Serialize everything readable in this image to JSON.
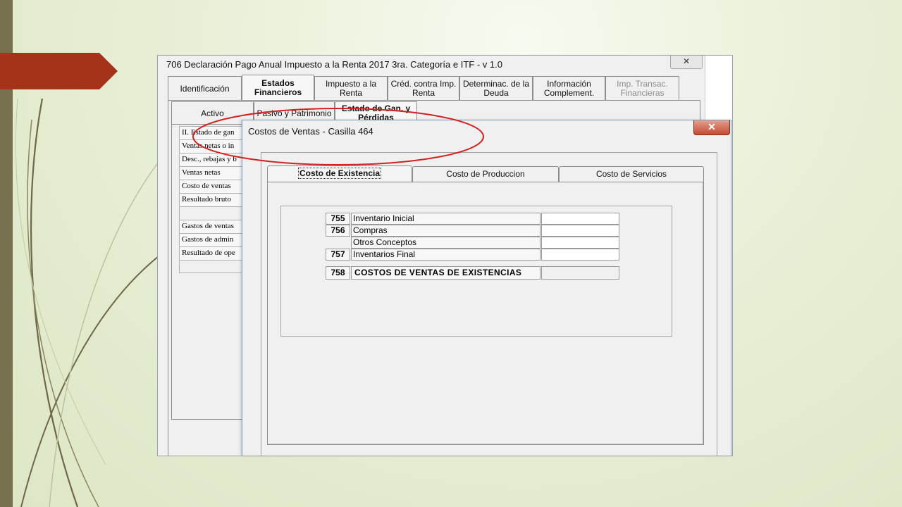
{
  "main_window": {
    "title": "706 Declaración Pago Anual Impuesto a la Renta 2017 3ra. Categoría e ITF - v 1.0",
    "close_label": "✕",
    "tabs": [
      {
        "label": "Identificación"
      },
      {
        "label": "Estados Financieros"
      },
      {
        "label": "Impuesto a la Renta"
      },
      {
        "label": "Créd. contra Imp. Renta"
      },
      {
        "label": "Determinac. de la Deuda"
      },
      {
        "label": "Información Complement."
      },
      {
        "label": "Imp. Transac. Financieras"
      }
    ],
    "subtabs": [
      {
        "label": "Activo"
      },
      {
        "label": "Pasivo y Patrimonio"
      },
      {
        "label": "Estado de Gan. y Pérdidas"
      }
    ],
    "rows": [
      "II. Estado de gan",
      "Ventas netas o in",
      "Desc., rebajas y b",
      "Ventas netas",
      "Costo de ventas",
      "Resultado bruto",
      "",
      "Gastos de ventas",
      "Gastos de admin",
      "Resultado de ope",
      ""
    ]
  },
  "dialog": {
    "title": "Costos de Ventas - Casilla 464",
    "close_label": "✕",
    "tabs": [
      {
        "label": "Costo de Existencia"
      },
      {
        "label": "Costo de Produccion"
      },
      {
        "label": "Costo de Servicios"
      }
    ],
    "rows": [
      {
        "code": "755",
        "label": "Inventario Inicial",
        "value": ""
      },
      {
        "code": "756",
        "label": "Compras",
        "value": ""
      },
      {
        "code": "",
        "label": "Otros Conceptos",
        "value": ""
      },
      {
        "code": "757",
        "label": "Inventarios Final",
        "value": ""
      }
    ],
    "total": {
      "code": "758",
      "label": "COSTOS DE VENTAS DE EXISTENCIAS",
      "value": ""
    }
  },
  "colors": {
    "background": "#e8efd6",
    "left_bar": "#77704f",
    "red_flag": "#a5331a",
    "highlight_ellipse": "#d32020"
  }
}
